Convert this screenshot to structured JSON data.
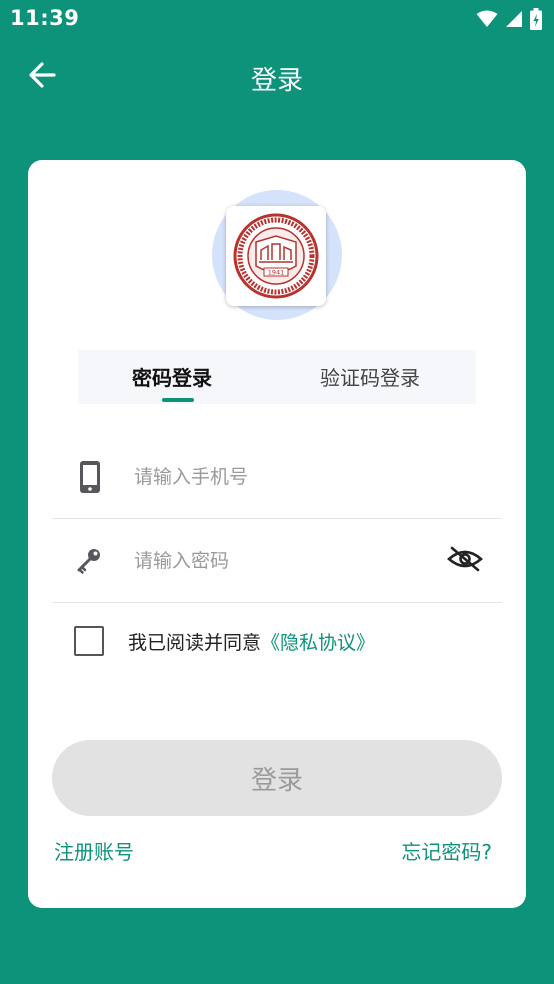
{
  "status_bar": {
    "time": "11:39"
  },
  "app_bar": {
    "title": "登录"
  },
  "logo": {
    "year": "1941"
  },
  "tabs": [
    {
      "label": "密码登录",
      "active": true
    },
    {
      "label": "验证码登录",
      "active": false
    }
  ],
  "form": {
    "phone_placeholder": "请输入手机号",
    "password_placeholder": "请输入密码"
  },
  "agreement": {
    "text": "我已阅读并同意",
    "link": "《隐私协议》",
    "checked": false
  },
  "login_button": {
    "label": "登录"
  },
  "links": {
    "register": "注册账号",
    "forgot": "忘记密码?"
  },
  "colors": {
    "primary": "#0d937a",
    "card": "#ffffff",
    "button_disabled": "#e2e2e2",
    "logo_halo": "#d4e2fb"
  },
  "icons": {
    "status": [
      "wifi-icon",
      "signal-icon",
      "battery-icon"
    ],
    "back": "arrow-left-icon",
    "phone": "phone-icon",
    "password": "key-icon",
    "visibility": "eye-off-icon"
  }
}
